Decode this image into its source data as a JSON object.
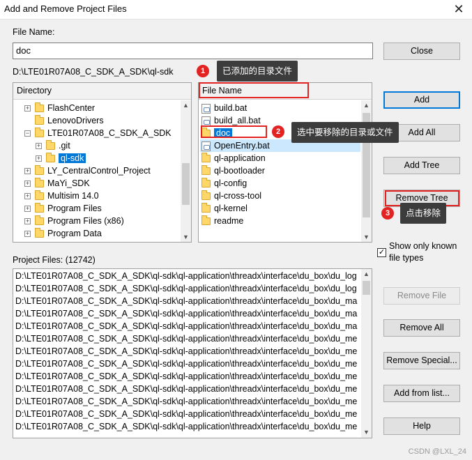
{
  "window": {
    "title": "Add and Remove Project Files",
    "close_glyph": "✕"
  },
  "file_name": {
    "label": "File Name:",
    "value": "doc"
  },
  "current_path": "D:\\LTE01R07A08_C_SDK_A_SDK\\ql-sdk",
  "directory": {
    "header": "Directory",
    "items": [
      {
        "label": "FlashCenter",
        "expander": "+",
        "level": 1
      },
      {
        "label": "LenovoDrivers",
        "expander": "",
        "level": 1
      },
      {
        "label": "LTE01R07A08_C_SDK_A_SDK",
        "expander": "−",
        "level": 1
      },
      {
        "label": ".git",
        "expander": "+",
        "level": 2
      },
      {
        "label": "ql-sdk",
        "expander": "+",
        "level": 2,
        "selected": true
      },
      {
        "label": "LY_CentralControl_Project",
        "expander": "+",
        "level": 1
      },
      {
        "label": "MaYi_SDK",
        "expander": "+",
        "level": 1
      },
      {
        "label": "Multisim 14.0",
        "expander": "+",
        "level": 1
      },
      {
        "label": "Program Files",
        "expander": "+",
        "level": 1
      },
      {
        "label": "Program Files (x86)",
        "expander": "+",
        "level": 1
      },
      {
        "label": "Program Data",
        "expander": "+",
        "level": 1
      }
    ]
  },
  "file_list": {
    "header": "File Name",
    "items": [
      {
        "label": "build.bat",
        "icon": "file"
      },
      {
        "label": "build_all.bat",
        "icon": "file"
      },
      {
        "label": "doc",
        "icon": "folder",
        "selected": true
      },
      {
        "label": "OpenEntry.bat",
        "icon": "file",
        "highlight": true
      },
      {
        "label": "ql-application",
        "icon": "folder"
      },
      {
        "label": "ql-bootloader",
        "icon": "folder"
      },
      {
        "label": "ql-config",
        "icon": "folder"
      },
      {
        "label": "ql-cross-tool",
        "icon": "folder"
      },
      {
        "label": "ql-kernel",
        "icon": "folder"
      },
      {
        "label": "readme",
        "icon": "folder"
      }
    ]
  },
  "buttons": {
    "close": "Close",
    "add": "Add",
    "add_all": "Add All",
    "add_tree": "Add Tree",
    "remove_tree": "Remove Tree",
    "remove_file": "Remove File",
    "remove_all": "Remove All",
    "remove_special": "Remove Special...",
    "add_from_list": "Add from list...",
    "help": "Help"
  },
  "checkbox": {
    "label_line1": "Show only known",
    "label_line2": "file types",
    "checked": true,
    "mark": "✓"
  },
  "project_files": {
    "label": "Project Files: (12742)",
    "rows": [
      "D:\\LTE01R07A08_C_SDK_A_SDK\\ql-sdk\\ql-application\\threadx\\interface\\du_box\\du_log",
      "D:\\LTE01R07A08_C_SDK_A_SDK\\ql-sdk\\ql-application\\threadx\\interface\\du_box\\du_log",
      "D:\\LTE01R07A08_C_SDK_A_SDK\\ql-sdk\\ql-application\\threadx\\interface\\du_box\\du_ma",
      "D:\\LTE01R07A08_C_SDK_A_SDK\\ql-sdk\\ql-application\\threadx\\interface\\du_box\\du_ma",
      "D:\\LTE01R07A08_C_SDK_A_SDK\\ql-sdk\\ql-application\\threadx\\interface\\du_box\\du_ma",
      "D:\\LTE01R07A08_C_SDK_A_SDK\\ql-sdk\\ql-application\\threadx\\interface\\du_box\\du_me",
      "D:\\LTE01R07A08_C_SDK_A_SDK\\ql-sdk\\ql-application\\threadx\\interface\\du_box\\du_me",
      "D:\\LTE01R07A08_C_SDK_A_SDK\\ql-sdk\\ql-application\\threadx\\interface\\du_box\\du_me",
      "D:\\LTE01R07A08_C_SDK_A_SDK\\ql-sdk\\ql-application\\threadx\\interface\\du_box\\du_me",
      "D:\\LTE01R07A08_C_SDK_A_SDK\\ql-sdk\\ql-application\\threadx\\interface\\du_box\\du_me",
      "D:\\LTE01R07A08_C_SDK_A_SDK\\ql-sdk\\ql-application\\threadx\\interface\\du_box\\du_me",
      "D:\\LTE01R07A08_C_SDK_A_SDK\\ql-sdk\\ql-application\\threadx\\interface\\du_box\\du_me",
      "D:\\LTE01R07A08_C_SDK_A_SDK\\ql-sdk\\ql-application\\threadx\\interface\\du_box\\du_me"
    ]
  },
  "annotations": [
    {
      "number": "1",
      "text": "已添加的目录文件"
    },
    {
      "number": "2",
      "text": "选中要移除的目录或文件"
    },
    {
      "number": "3",
      "text": "点击移除"
    }
  ],
  "watermark": "CSDN @LXL_24"
}
